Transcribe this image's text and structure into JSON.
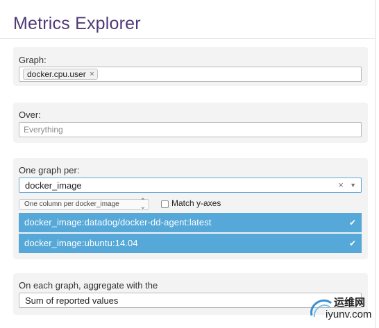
{
  "page": {
    "title": "Metrics Explorer"
  },
  "graph": {
    "label": "Graph:",
    "tag": "docker.cpu.user",
    "tag_remove": "×"
  },
  "over": {
    "label": "Over:",
    "placeholder": "Everything"
  },
  "one_graph_per": {
    "label": "One graph per:",
    "selected": "docker_image",
    "clear": "×",
    "layout_select": "One column per docker_image",
    "match_y_axes_label": "Match y-axes",
    "match_y_axes_checked": false,
    "options": [
      {
        "label": "docker_image:datadog/docker-dd-agent:latest",
        "checked": true
      },
      {
        "label": "docker_image:ubuntu:14.04",
        "checked": true
      }
    ],
    "check_glyph": "✔"
  },
  "aggregate": {
    "label": "On each graph, aggregate with the",
    "selected": "Sum of reported values"
  },
  "watermark": {
    "line1": "运维网",
    "line2": "iyunv.com"
  },
  "colors": {
    "title": "#4e3a76",
    "selected_option": "#55a8d8",
    "panel": "#f3f3f3"
  }
}
